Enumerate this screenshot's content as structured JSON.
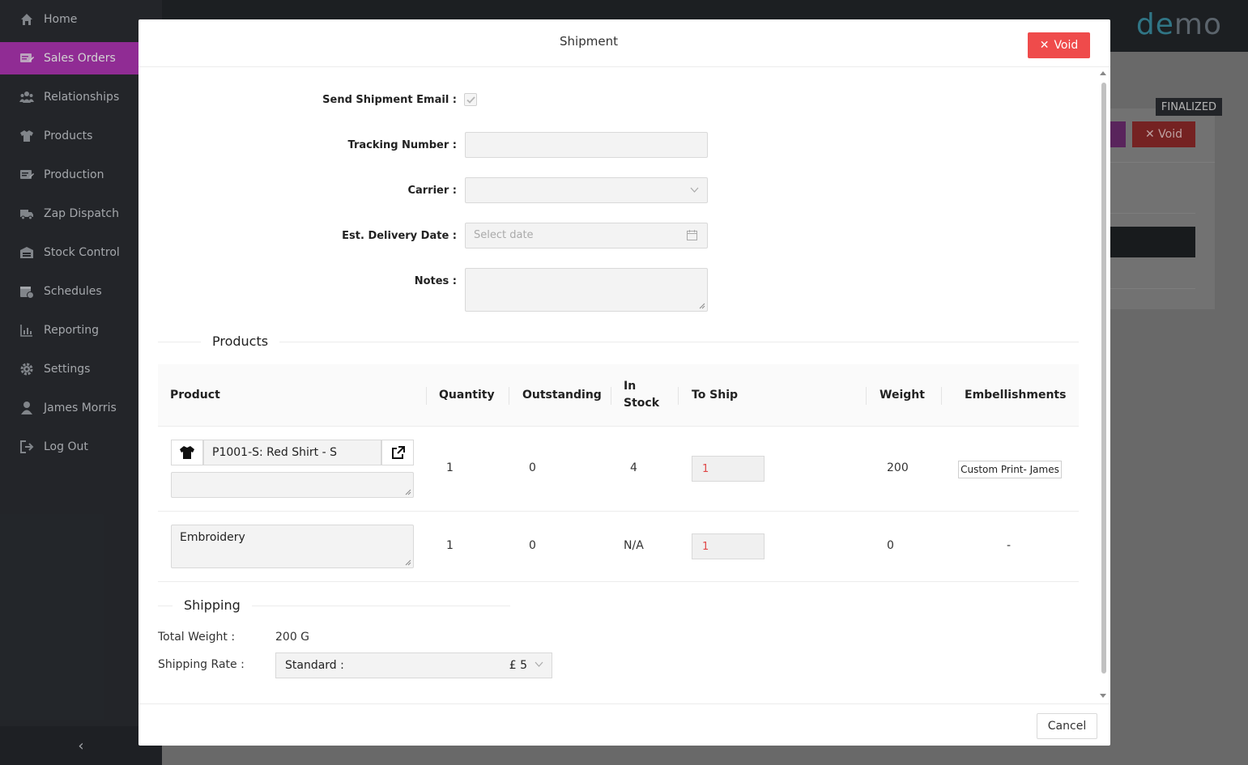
{
  "sidebar": {
    "items": [
      {
        "label": "Home",
        "icon": "home-icon"
      },
      {
        "label": "Sales Orders",
        "icon": "sales-orders-icon",
        "active": true
      },
      {
        "label": "Relationships",
        "icon": "people-icon"
      },
      {
        "label": "Products",
        "icon": "shirt-icon"
      },
      {
        "label": "Production",
        "icon": "production-icon"
      },
      {
        "label": "Zap Dispatch",
        "icon": "truck-icon"
      },
      {
        "label": "Stock Control",
        "icon": "warehouse-icon"
      },
      {
        "label": "Schedules",
        "icon": "calendar-icon"
      },
      {
        "label": "Reporting",
        "icon": "chart-icon"
      },
      {
        "label": "Settings",
        "icon": "gear-icon"
      },
      {
        "label": "James Morris",
        "icon": "user-icon"
      },
      {
        "label": "Log Out",
        "icon": "logout-icon"
      }
    ],
    "collapse_glyph": "‹"
  },
  "brand": {
    "prefix": "de",
    "suffix": "mo"
  },
  "background": {
    "status_badge": "FINALIZED",
    "void_label": "Void"
  },
  "modal": {
    "title": "Shipment",
    "void_label": "Void",
    "form": {
      "send_email_label": "Send Shipment Email :",
      "send_email_checked": true,
      "tracking_label": "Tracking Number :",
      "tracking_value": "",
      "carrier_label": "Carrier :",
      "carrier_value": "",
      "delivery_label": "Est. Delivery Date :",
      "delivery_placeholder": "Select date",
      "notes_label": "Notes :",
      "notes_value": ""
    },
    "products_title": "Products",
    "columns": {
      "product": "Product",
      "quantity": "Quantity",
      "outstanding": "Outstanding",
      "in_stock_1": "In",
      "in_stock_2": "Stock",
      "to_ship": "To Ship",
      "weight": "Weight",
      "embellishments": "Embellishments"
    },
    "rows": [
      {
        "product": "P1001-S: Red Shirt - S",
        "quantity": "1",
        "outstanding": "0",
        "in_stock": "4",
        "to_ship": "1",
        "weight": "200",
        "embellishment": "Custom Print- James"
      },
      {
        "product": "Embroidery",
        "quantity": "1",
        "outstanding": "0",
        "in_stock": "N/A",
        "to_ship": "1",
        "weight": "0",
        "embellishment": "-"
      }
    ],
    "shipping_title": "Shipping",
    "total_weight_label": "Total Weight :",
    "total_weight_value": "200 G",
    "shipping_rate_label": "Shipping Rate :",
    "shipping_rate_name": "Standard :",
    "shipping_rate_price": "£ 5",
    "cancel_label": "Cancel"
  },
  "colors": {
    "accent": "#b036b5",
    "danger": "#ef4b4b",
    "brand": "#3b8fa3"
  }
}
